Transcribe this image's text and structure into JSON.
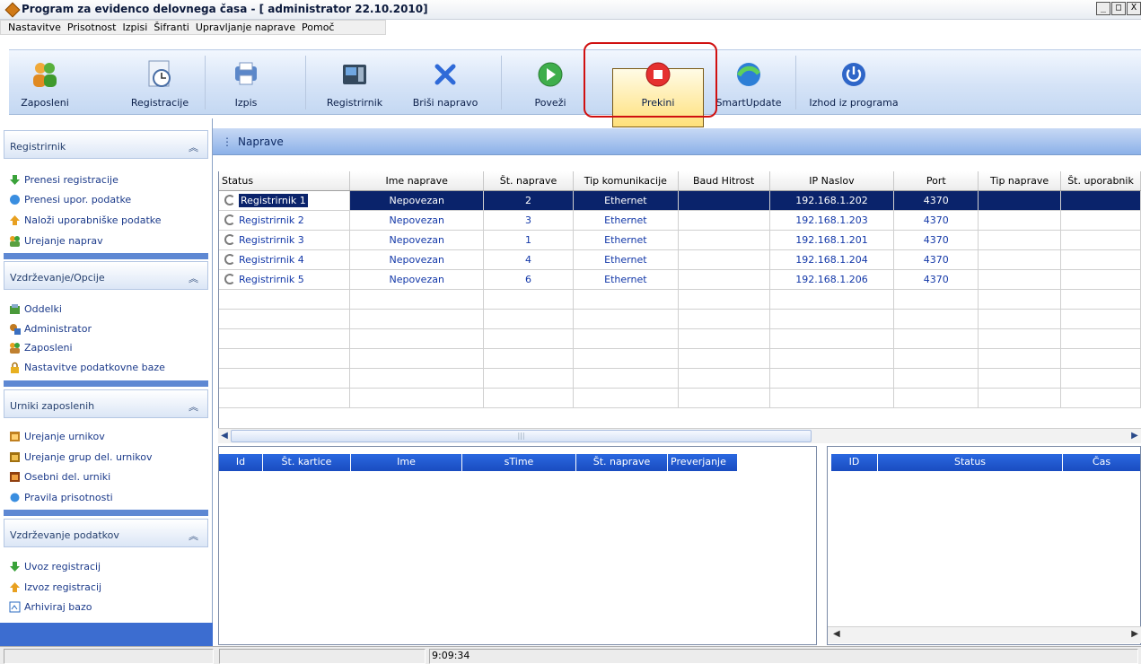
{
  "window": {
    "title": "Program za evidenco delovnega časa - [ administrator 22.10.2010]",
    "min": "_",
    "max": "□",
    "close": "X"
  },
  "menu": [
    "Nastavitve",
    "Prisotnost",
    "Izpisi",
    "Šifranti",
    "Upravljanje naprave",
    "Pomoč"
  ],
  "toolbar": {
    "zaposleni": "Zaposleni",
    "registracije": "Registracije",
    "izpis": "Izpis",
    "registrirnik": "Registrirnik",
    "brisi": "Briši napravo",
    "povezi": "Poveži",
    "prekini": "Prekini",
    "smartupdate": "SmartUpdate",
    "izhod": "Izhod iz programa"
  },
  "sidebar": {
    "sections": [
      {
        "title": "Registrirnik",
        "items": [
          "Prenesi registracije",
          "Prenesi upor. podatke",
          "Naloži uporabniške podatke",
          "Urejanje naprav"
        ]
      },
      {
        "title": "Vzdrževanje/Opcije",
        "items": [
          "Oddelki",
          "Administrator",
          "Zaposleni",
          "Nastavitve podatkovne baze"
        ]
      },
      {
        "title": "Urniki zaposlenih",
        "items": [
          "Urejanje urnikov",
          "Urejanje grup del. urnikov",
          "Osebni del. urniki",
          "Pravila prisotnosti"
        ]
      },
      {
        "title": "Vzdrževanje podatkov",
        "items": [
          "Uvoz registracij",
          "Izvoz registracij",
          "Arhiviraj bazo"
        ]
      }
    ]
  },
  "panel": {
    "title": "Naprave"
  },
  "devices": {
    "columns": [
      "Status",
      "Ime naprave",
      "Št. naprave",
      "Tip komunikacije",
      "Baud Hitrost",
      "IP Naslov",
      "Port",
      "Tip naprave",
      "Št. uporabnik"
    ],
    "rows": [
      {
        "name": "Registrirnik 1",
        "status": "Nepovezan",
        "num": "2",
        "comm": "Ethernet",
        "baud": "",
        "ip": "192.168.1.202",
        "port": "4370",
        "type": "",
        "users": ""
      },
      {
        "name": "Registrirnik 2",
        "status": "Nepovezan",
        "num": "3",
        "comm": "Ethernet",
        "baud": "",
        "ip": "192.168.1.203",
        "port": "4370",
        "type": "",
        "users": ""
      },
      {
        "name": "Registrirnik 3",
        "status": "Nepovezan",
        "num": "1",
        "comm": "Ethernet",
        "baud": "",
        "ip": "192.168.1.201",
        "port": "4370",
        "type": "",
        "users": ""
      },
      {
        "name": "Registrirnik 4",
        "status": "Nepovezan",
        "num": "4",
        "comm": "Ethernet",
        "baud": "",
        "ip": "192.168.1.204",
        "port": "4370",
        "type": "",
        "users": ""
      },
      {
        "name": "Registrirnik 5",
        "status": "Nepovezan",
        "num": "6",
        "comm": "Ethernet",
        "baud": "",
        "ip": "192.168.1.206",
        "port": "4370",
        "type": "",
        "users": ""
      }
    ],
    "selected_row": 0
  },
  "log_left": {
    "columns": [
      "Id",
      "Št. kartice",
      "Ime",
      "sTime",
      "Št. naprave",
      "Preverjanje"
    ]
  },
  "log_right": {
    "columns": [
      "ID",
      "Status",
      "Čas"
    ]
  },
  "statusbar": {
    "time": "9:09:34"
  },
  "colors": {
    "selected_row": "#0a236b",
    "link_text": "#1338a8",
    "highlight_frame": "#d01010",
    "header_blue": "#1a4cc0"
  }
}
